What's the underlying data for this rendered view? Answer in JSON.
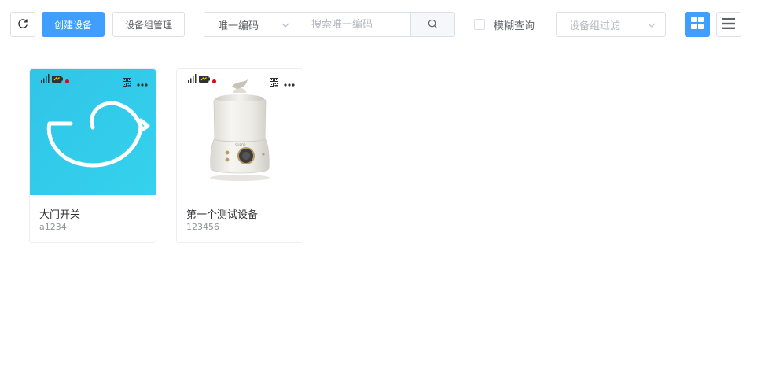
{
  "toolbar": {
    "create_label": "创建设备",
    "group_manage_label": "设备组管理",
    "code_select_value": "唯一编码",
    "search_placeholder": "搜索唯一编码",
    "fuzzy_label": "模糊查询",
    "group_filter_placeholder": "设备组过滤",
    "accent_color": "#409eff"
  },
  "devices": [
    {
      "name": "大门开关",
      "code": "a1234",
      "image": "bird-logo",
      "bg_color": "#33cbea",
      "online": false
    },
    {
      "name": "第一个测试设备",
      "code": "123456",
      "image": "humidifier",
      "bg_color": "#ffffff",
      "online": false
    }
  ],
  "icons": {
    "refresh": "refresh-icon",
    "search": "search-icon",
    "grid": "grid-view-icon",
    "list": "list-view-icon",
    "signal": "signal-icon",
    "battery": "battery-icon",
    "qr": "qr-code-icon",
    "more": "more-icon"
  }
}
